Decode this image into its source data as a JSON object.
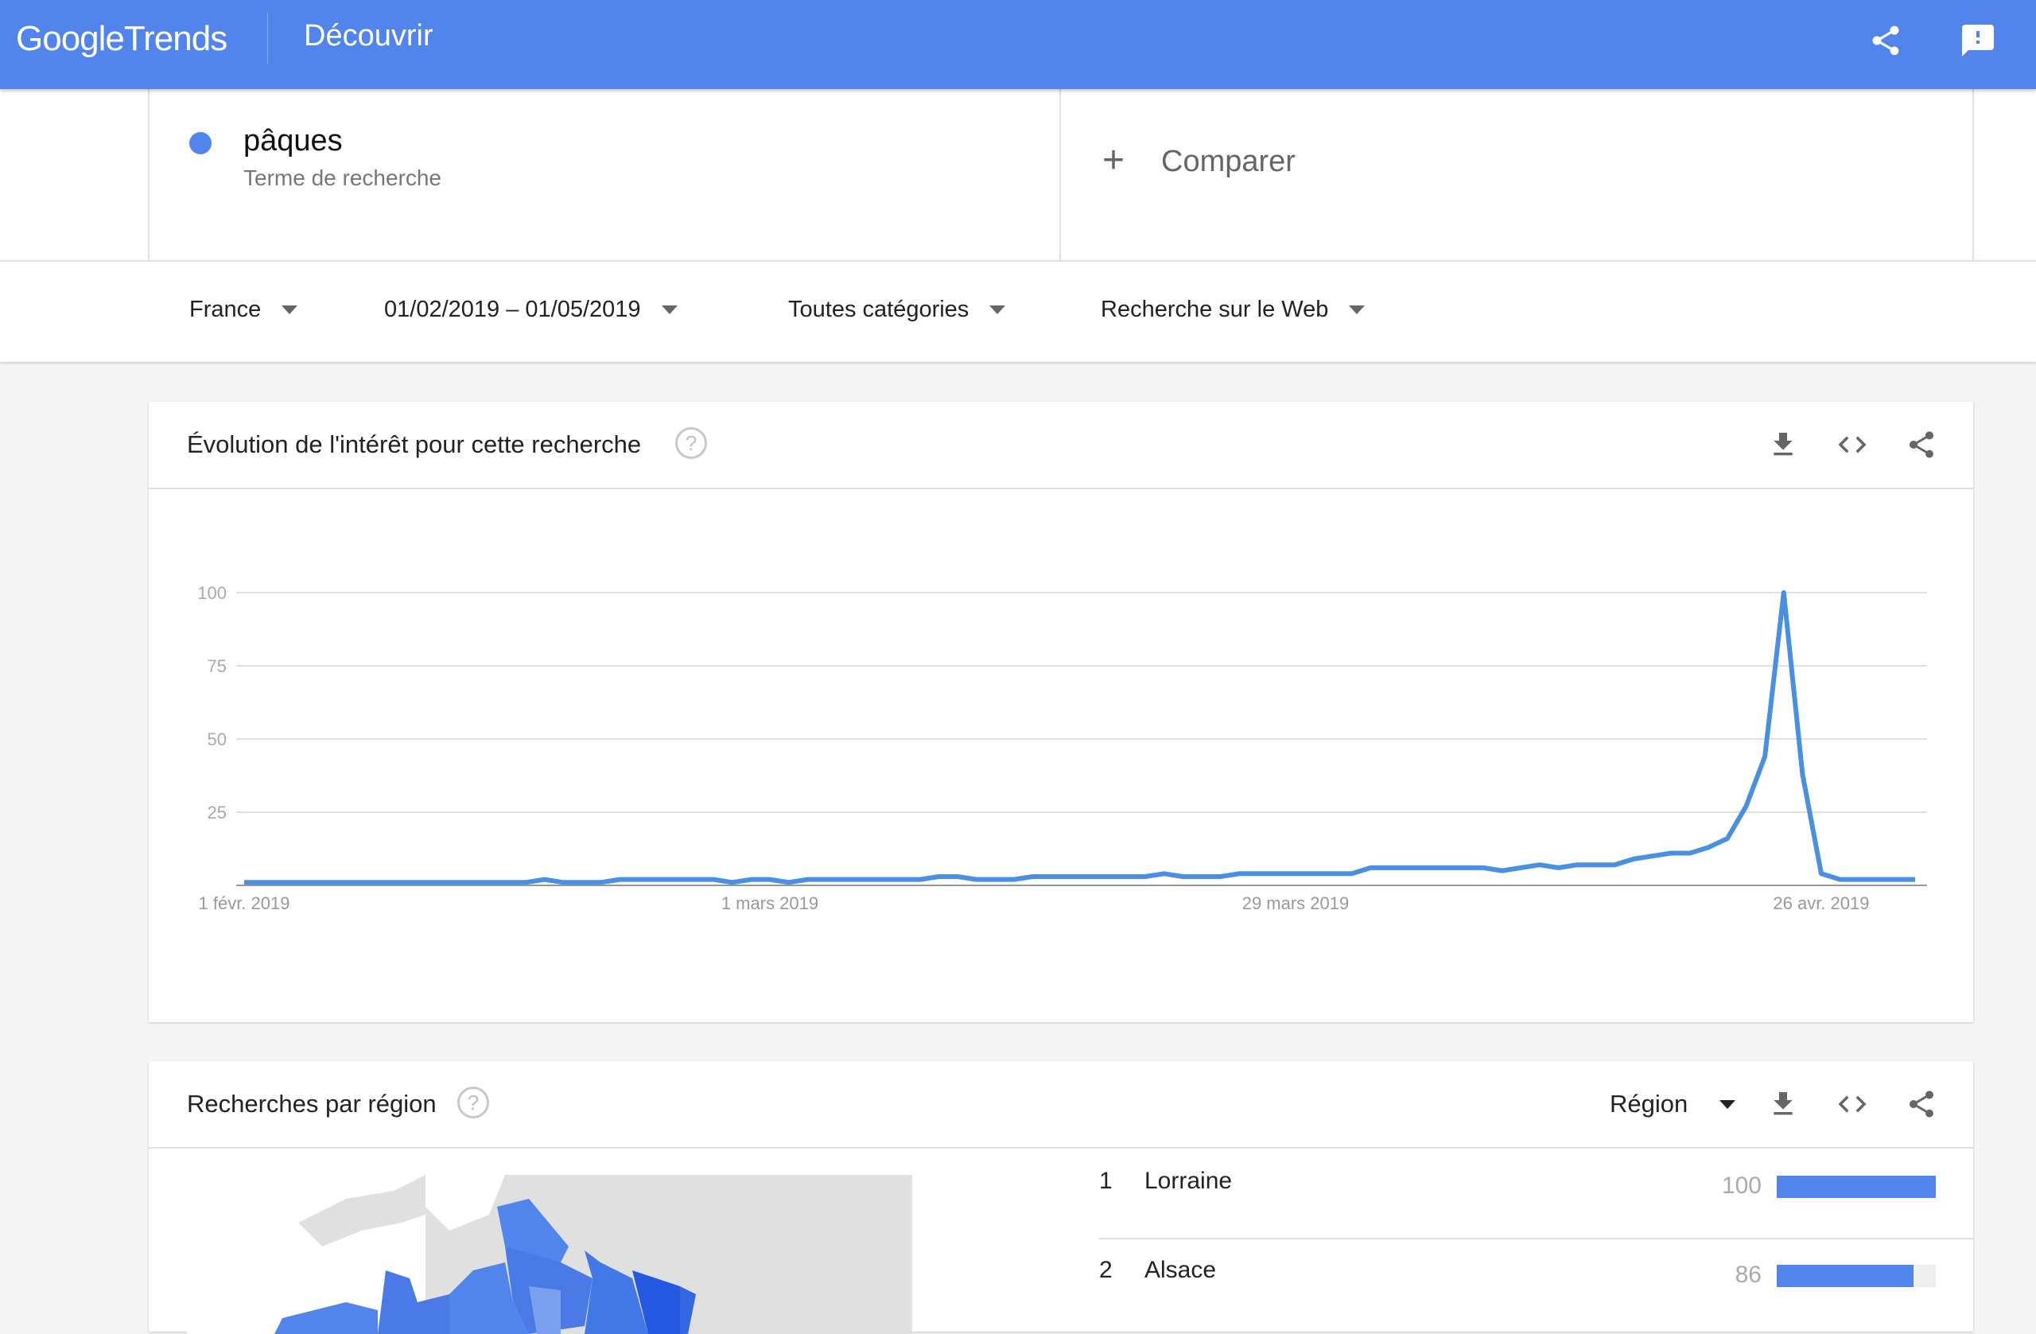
{
  "app": {
    "logo_google": "Google",
    "logo_trends": "Trends",
    "title": "Découvrir",
    "icons": [
      "share-icon",
      "feedback-icon"
    ]
  },
  "search": {
    "term": "pâques",
    "term_type": "Terme de recherche",
    "term_color": "#5285ec",
    "compare_label": "Comparer"
  },
  "filters": {
    "region": "France",
    "date_range": "01/02/2019 – 01/05/2019",
    "category": "Toutes catégories",
    "search_type": "Recherche sur le Web"
  },
  "interest_card": {
    "title": "Évolution de l'intérêt pour cette recherche",
    "help": "?",
    "icons": [
      "download-icon",
      "embed-icon",
      "share-icon"
    ]
  },
  "chart_data": {
    "type": "line",
    "title": "Évolution de l'intérêt pour cette recherche",
    "xlabel": "",
    "ylabel": "",
    "ylim": [
      0,
      100
    ],
    "yticks": [
      "100",
      "75",
      "50",
      "25"
    ],
    "ytick_values": [
      100,
      75,
      50,
      25
    ],
    "grid": true,
    "x_start": "2019-02-01",
    "x_end": "2019-05-01",
    "xtick_labels": [
      {
        "label": "1 févr. 2019",
        "day_index": 0
      },
      {
        "label": "1 mars 2019",
        "day_index": 28
      },
      {
        "label": "29 mars 2019",
        "day_index": 56
      },
      {
        "label": "26 avr. 2019",
        "day_index": 84
      }
    ],
    "series": [
      {
        "name": "pâques",
        "color": "#4a90e2",
        "values": [
          1,
          1,
          1,
          1,
          1,
          1,
          1,
          1,
          1,
          1,
          1,
          1,
          1,
          1,
          1,
          1,
          2,
          1,
          1,
          1,
          2,
          2,
          2,
          2,
          2,
          2,
          1,
          2,
          2,
          1,
          2,
          2,
          2,
          2,
          2,
          2,
          2,
          3,
          3,
          2,
          2,
          2,
          3,
          3,
          3,
          3,
          3,
          3,
          3,
          4,
          3,
          3,
          3,
          4,
          4,
          4,
          4,
          4,
          4,
          4,
          6,
          6,
          6,
          6,
          6,
          6,
          6,
          5,
          6,
          7,
          6,
          7,
          7,
          7,
          9,
          10,
          11,
          11,
          13,
          16,
          27,
          44,
          100,
          38,
          4,
          2,
          2,
          2,
          2,
          2
        ]
      }
    ]
  },
  "region_card": {
    "title": "Recherches par région",
    "help": "?",
    "resolution_select": "Région",
    "icons": [
      "download-icon",
      "embed-icon",
      "share-icon"
    ],
    "rows": [
      {
        "rank": "1",
        "name": "Lorraine",
        "value": "100",
        "fraction": 1.0
      },
      {
        "rank": "2",
        "name": "Alsace",
        "value": "86",
        "fraction": 0.86
      }
    ]
  }
}
